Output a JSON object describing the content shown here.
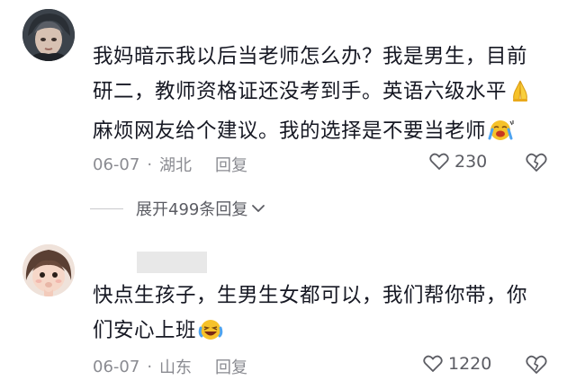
{
  "comments": [
    {
      "lines": [
        "我妈暗示我以后当老师怎么办？我是男生，目前",
        "研二，教师资格证还没考到手。英语六级水平",
        "麻烦网友给个建议。我的选择是不要当老师"
      ],
      "date": "06-07",
      "location": "湖北",
      "reply_label": "回复",
      "likes": "230",
      "expand_label": "展开499条回复"
    },
    {
      "lines": [
        "快点生孩子，生男生女都可以，我们帮你带，你",
        "们安心上班"
      ],
      "date": "06-07",
      "location": "山东",
      "reply_label": "回复",
      "likes": "1220"
    }
  ],
  "icons": {
    "pray": "folded-hands-emoji",
    "sob": "loudly-crying-emoji",
    "laugh": "tears-of-joy-emoji",
    "like": "heart-outline-icon",
    "dislike": "broken-heart-outline-icon",
    "chevron": "chevron-down-icon"
  },
  "colors": {
    "text": "#161823",
    "meta": "#8a8b91",
    "accent_emoji": "#f6c22a"
  }
}
